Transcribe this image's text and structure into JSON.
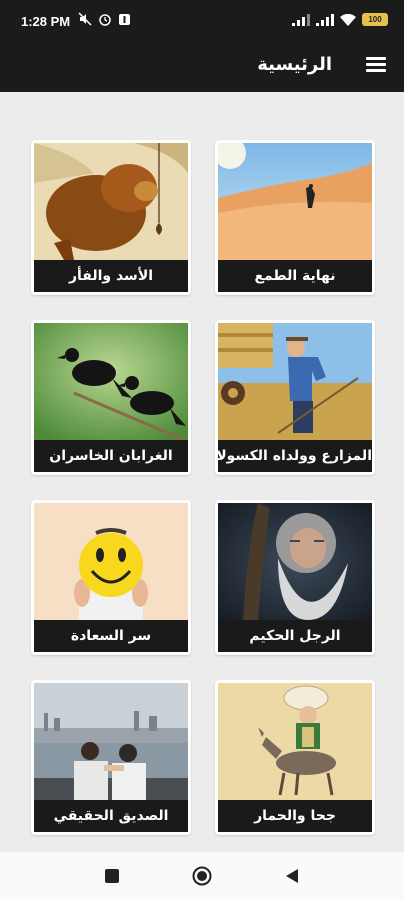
{
  "status": {
    "time": "1:28 PM",
    "battery": "100"
  },
  "app_bar": {
    "title": "الرئيسية",
    "menu_icon": "hamburger-menu-icon"
  },
  "stories": [
    {
      "title": "نهاية الطمع",
      "image": "desert-traveler"
    },
    {
      "title": "الأسد والفأر",
      "image": "lion"
    },
    {
      "title": "المزارع وولداه الكسولان",
      "image": "farmer"
    },
    {
      "title": "الغرابان الخاسران",
      "image": "crows"
    },
    {
      "title": "الرجل الحكيم",
      "image": "wise-old-man"
    },
    {
      "title": "سر السعادة",
      "image": "smiley-face"
    },
    {
      "title": "جحا والحمار",
      "image": "juha-donkey"
    },
    {
      "title": "الصديق الحقيقي",
      "image": "friends"
    }
  ],
  "nav": {
    "recents_icon": "square-icon",
    "home_icon": "circle-icon",
    "back_icon": "triangle-back-icon"
  },
  "colors": {
    "bar": "#1b1b1b",
    "background": "#ececec",
    "card_label": "#1a1a1a"
  }
}
